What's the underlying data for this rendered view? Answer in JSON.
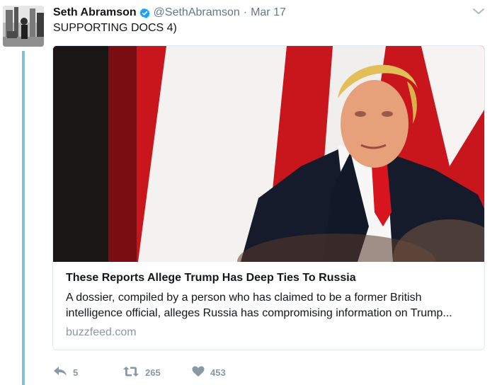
{
  "tweet": {
    "author_name": "Seth Abramson",
    "author_handle": "@SethAbramson",
    "separator": "·",
    "date": "Mar 17",
    "text": "SUPPORTING DOCS 4)",
    "verified": true,
    "verified_icon": "verified-badge-icon",
    "more_icon": "chevron-down-icon"
  },
  "card": {
    "title": "These Reports Allege Trump Has Deep Ties To Russia",
    "description_line1": "A dossier, compiled by a person who has claimed to be a former British",
    "description_line2": "intelligence official, alleges Russia has compromising information on Trump...",
    "domain": "buzzfeed.com"
  },
  "actions": {
    "reply_count": "5",
    "retweet_count": "265",
    "like_count": "453",
    "reply_icon": "reply-icon",
    "retweet_icon": "retweet-icon",
    "like_icon": "heart-icon"
  },
  "colors": {
    "verified_blue": "#1da1f2",
    "thread_line": "#7fc2d4",
    "secondary_text": "#657786",
    "muted_text": "#8899a6",
    "border": "#e1e8ed"
  }
}
